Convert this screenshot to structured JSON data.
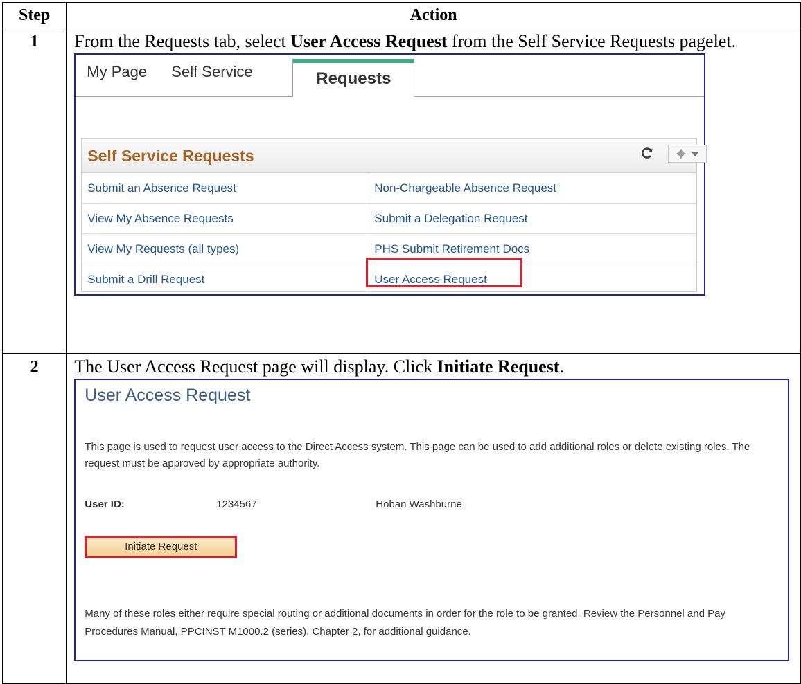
{
  "table": {
    "headers": {
      "step": "Step",
      "action": "Action"
    }
  },
  "step1": {
    "number": "1",
    "instruction_pre": "From the Requests tab, select ",
    "instruction_bold": "User Access Request",
    "instruction_post": " from the Self Service Requests pagelet.",
    "screenshot": {
      "tabs": [
        "My Page",
        "Self Service",
        "Requests"
      ],
      "selected_tab": "Requests",
      "pagelet_title": "Self Service Requests",
      "links_left": [
        "Submit an Absence Request",
        "View My Absence Requests",
        "View My Requests (all types)",
        "Submit a Drill Request"
      ],
      "links_right": [
        "Non-Chargeable Absence Request",
        "Submit a Delegation Request",
        "PHS Submit Retirement Docs",
        "User Access Request"
      ],
      "highlighted_link": "User Access Request",
      "icons": {
        "refresh": "refresh-icon",
        "settings": "gear-icon"
      }
    }
  },
  "step2": {
    "number": "2",
    "instruction_pre": "The User Access Request page will display.  Click ",
    "instruction_bold": "Initiate Request",
    "instruction_post": ".",
    "screenshot": {
      "page_title": "User Access Request",
      "description": "This page is used to request user access to the Direct Access system. This page can be used to add additional roles or delete existing roles. The request must be approved by appropriate authority.",
      "user_id_label": "User ID:",
      "user_id_value": "1234567",
      "user_name": "Hoban Washburne",
      "button_label": "Initiate Request",
      "note": "Many of these roles either require special routing or additional documents in order for the role to be granted. Review the Personnel and Pay Procedures Manual, PPCINST M1000.2 (series), Chapter 2, for additional guidance."
    }
  },
  "colors": {
    "screenshot_border": "#1f1fb5",
    "highlight": "#e0202a",
    "tab_accent": "#3fae8a",
    "pagelet_title": "#a66321",
    "link": "#22558c",
    "page_title": "#3a5b85",
    "button_fill": "#f2d296"
  }
}
